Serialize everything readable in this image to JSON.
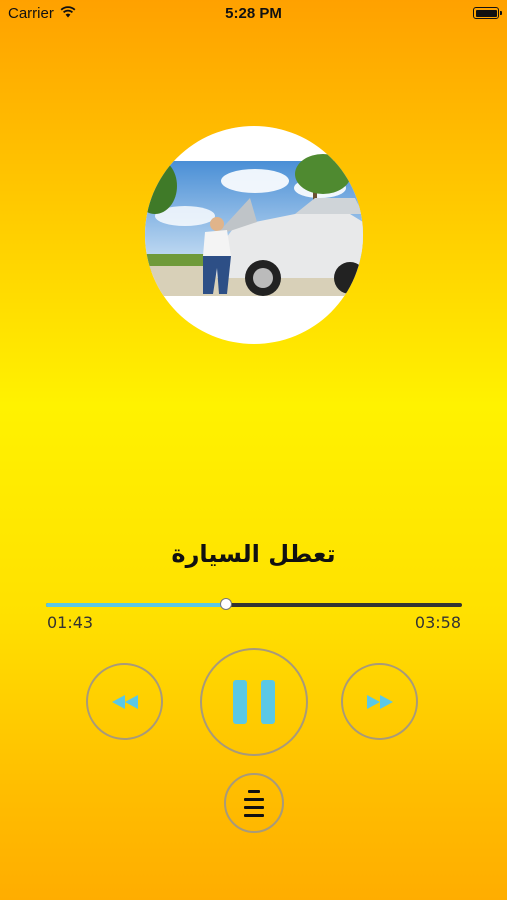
{
  "status_bar": {
    "carrier": "Carrier",
    "time": "5:28 PM",
    "wifi_icon": "wifi-icon",
    "battery_icon": "battery-icon"
  },
  "player": {
    "track_title": "تعطل السيارة",
    "elapsed": "01:43",
    "duration": "03:58",
    "progress": 0.433,
    "artwork": "car-breakdown-photo"
  },
  "controls": {
    "rewind_icon": "rewind-icon",
    "pause_icon": "pause-icon",
    "forward_icon": "fast-forward-icon",
    "playlist_icon": "playlist-icon"
  },
  "colors": {
    "accent": "#5bc8e6",
    "track": "#333333",
    "button_border": "#a89a7a",
    "background_top": "#ffa100",
    "background_mid": "#fff200"
  }
}
